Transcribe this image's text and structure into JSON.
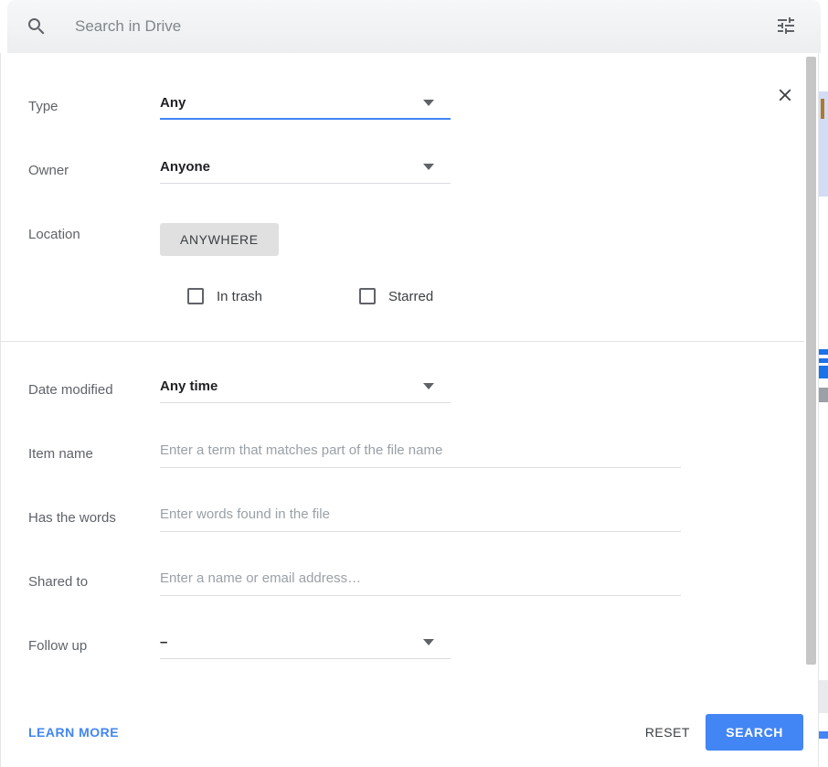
{
  "search": {
    "placeholder": "Search in Drive",
    "value": "",
    "icon": "search-icon",
    "tune_icon": "tune-icon"
  },
  "dialog": {
    "close_icon": "close-icon",
    "sections": [
      {
        "rows": [
          {
            "label": "Type",
            "kind": "select",
            "value": "Any",
            "focused": true
          },
          {
            "label": "Owner",
            "kind": "select",
            "value": "Anyone",
            "focused": false
          },
          {
            "label": "Location",
            "kind": "chip",
            "value": "ANYWHERE"
          }
        ],
        "checkboxes": [
          {
            "label": "In trash",
            "checked": false
          },
          {
            "label": "Starred",
            "checked": false
          }
        ]
      },
      {
        "rows": [
          {
            "label": "Date modified",
            "kind": "select",
            "value": "Any time",
            "focused": false
          },
          {
            "label": "Item name",
            "kind": "text",
            "value": "",
            "placeholder": "Enter a term that matches part of the file name"
          },
          {
            "label": "Has the words",
            "kind": "text",
            "value": "",
            "placeholder": "Enter words found in the file"
          },
          {
            "label": "Shared to",
            "kind": "text",
            "value": "",
            "placeholder": "Enter a name or email address…"
          },
          {
            "label": "Follow up",
            "kind": "select",
            "value": "–",
            "focused": false
          }
        ]
      }
    ]
  },
  "footer": {
    "learn_more": "LEARN MORE",
    "reset": "RESET",
    "search": "SEARCH"
  },
  "colors": {
    "accent": "#4285f4",
    "label": "#5f6368",
    "value": "#202124",
    "placeholder": "#9aa0a6",
    "chip_bg": "#e0e0e0",
    "divider": "#e3e3e3",
    "scrollbar": "#c6c6c6"
  }
}
